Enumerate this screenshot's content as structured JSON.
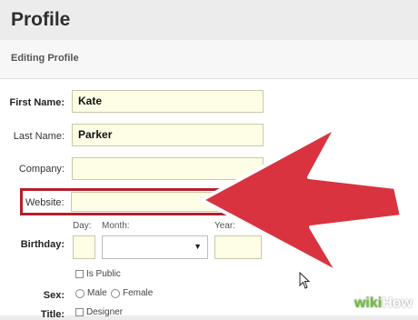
{
  "header": {
    "title": "Profile"
  },
  "section": {
    "title": "Editing Profile"
  },
  "form": {
    "first_name": {
      "label": "First Name:",
      "value": "Kate"
    },
    "last_name": {
      "label": "Last Name:",
      "value": "Parker"
    },
    "company": {
      "label": "Company:",
      "value": ""
    },
    "website": {
      "label": "Website:",
      "value": ""
    },
    "birthday": {
      "label": "Birthday:",
      "day_label": "Day:",
      "month_label": "Month:",
      "year_label": "Year:",
      "is_public_label": "Is Public"
    },
    "sex": {
      "label": "Sex:",
      "options": [
        "Male",
        "Female"
      ]
    },
    "title": {
      "label": "Title:",
      "option": "Designer"
    }
  },
  "overlay": {
    "arrow_color": "#d8333f",
    "arrow_outline": "#ffffff"
  },
  "watermark": {
    "wiki": "wiki",
    "how": "How"
  }
}
